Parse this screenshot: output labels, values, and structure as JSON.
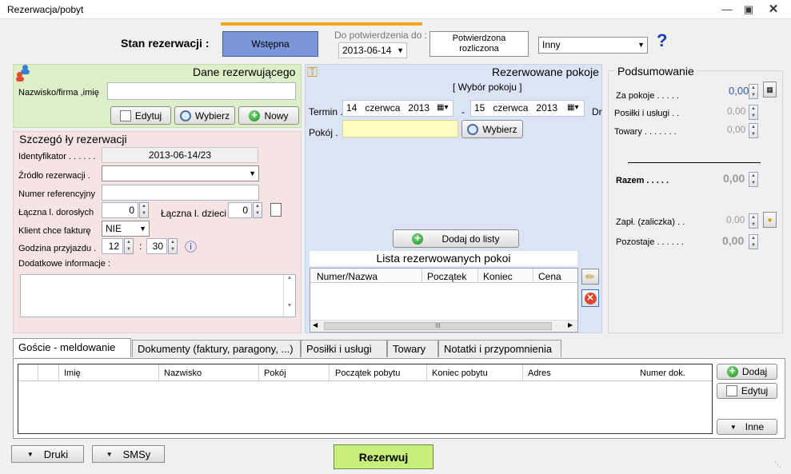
{
  "window": {
    "title": "Rezerwacja/pobyt"
  },
  "status": {
    "label": "Stan rezerwacji :",
    "current": "Wstępna",
    "confirm_label": "Do potwierdzenia do :",
    "confirm_date": "2013-06-14",
    "confirmed_line1": "Potwierdzona",
    "confirmed_line2": "rozliczona",
    "other": "Inny",
    "help": "?"
  },
  "booker": {
    "title": "Dane rezerwującego",
    "name_label": "Nazwisko/firma ,imię",
    "name_value": "",
    "edit": "Edytuj",
    "select": "Wybierz",
    "new": "Nowy"
  },
  "details": {
    "title": "Szczegó ły rezerwacji",
    "id_label": "Identyfikator . . . . . .",
    "id_value": "2013-06-14/23",
    "source_label": "Źródło rezerwacji .",
    "source_value": "",
    "ref_label": "Numer referencyjny",
    "ref_value": "",
    "adults_label": "Łączna l. dorosłych",
    "adults_value": "0",
    "children_label": "Łączna l. dzieci",
    "children_value": "0",
    "invoice_label": "Klient chce fakturę",
    "invoice_value": "NIE",
    "arrival_label": "Godzina przyjazdu .",
    "arrival_hour": "12",
    "arrival_sep": ":",
    "arrival_min": "30",
    "info_label": "Dodatkowe informacje :",
    "info_value": ""
  },
  "rooms": {
    "title": "Rezerwowane pokoje",
    "subtitle": "[ Wybór pokoju ]",
    "term_label": "Termin .",
    "from_day": "14",
    "from_month": "czerwca",
    "from_year": "2013",
    "dash": "-",
    "to_day": "15",
    "to_month": "czerwca",
    "to_year": "2013",
    "cut_label": "Dn",
    "room_label": "Pokój .",
    "room_value": "",
    "select": "Wybierz",
    "add_to_list": "Dodaj do listy",
    "list_title": "Lista rezerwowanych pokoi",
    "columns": [
      "Numer/Nazwa",
      "Początek",
      "Koniec",
      "Cena"
    ],
    "scroll_mid": "III"
  },
  "summary": {
    "title": "Podsumowanie",
    "rows": [
      {
        "label": "Za pokoje . . . . .",
        "value": "0,00"
      },
      {
        "label": "Posiłki i usługi . .",
        "value": "0,00"
      },
      {
        "label": "Towary . . . . . . .",
        "value": "0,00"
      }
    ],
    "total_label": "Razem . . . . .",
    "total_value": "0,00",
    "deposit_label": "Zapł. (zaliczka) . .",
    "deposit_value": "0,00",
    "remaining_label": "Pozostaje . . . . . .",
    "remaining_value": "0,00"
  },
  "tabs": [
    "Goście - meldowanie",
    "Dokumenty (faktury, paragony, ...)",
    "Posiłki i usługi",
    "Towary",
    "Notatki i przypomnienia"
  ],
  "guests": {
    "columns": [
      "Imię",
      "Nazwisko",
      "Pokój",
      "Początek pobytu",
      "Koniec pobytu",
      "Adres",
      "Numer dok."
    ],
    "add": "Dodaj",
    "edit": "Edytuj",
    "other": "Inne"
  },
  "footer": {
    "prints": "Druki",
    "sms": "SMSy",
    "reserve": "Rezerwuj"
  },
  "colors": {
    "status_active": "#7b96d9",
    "booker_bg": "#dcefc8",
    "details_bg": "#f5e4e3",
    "rooms_bg": "#dbe4f5",
    "room_input": "#fffcc0",
    "reserve_btn": "#c8ef7c",
    "orange_bar": "#f5a623",
    "summary_value": "#3355aa"
  }
}
